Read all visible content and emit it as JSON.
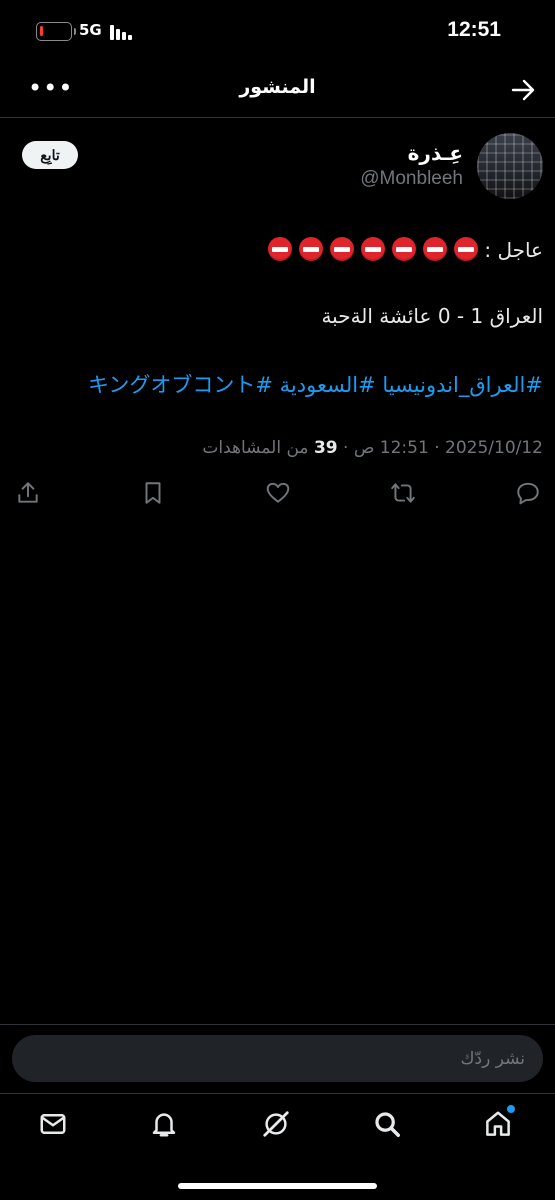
{
  "status_bar": {
    "time": "12:51",
    "network": "5G",
    "battery_level": 0.08,
    "battery_color": "#ff3b30"
  },
  "header": {
    "title": "المنشور",
    "back_icon": "arrow-right-icon",
    "more_icon": "more-horizontal-icon",
    "more_label": "•••"
  },
  "tweet": {
    "display_name": "عِـذرة",
    "handle": "@Monbleeh",
    "follow_label": "تابِع",
    "breaking_label": "عاجل :",
    "emoji_count": 7,
    "emoji_icon": "no-entry-icon",
    "score_line": "العراق 1 - 0 عائشة الةحبة",
    "hashtags": "#العراق_اندونيسيا #السعودية #キングオブコント",
    "date": "2025/10/12",
    "time": "12:51 ص",
    "views_count": "39",
    "views_label": "من المشاهدات"
  },
  "actions": {
    "items": [
      "share-icon",
      "bookmark-icon",
      "like-icon",
      "retweet-icon",
      "reply-icon"
    ]
  },
  "reply": {
    "placeholder": "نشر ردّك"
  },
  "bottom_nav": {
    "items": [
      "messages-icon",
      "notifications-icon",
      "grok-icon",
      "search-icon",
      "home-icon"
    ],
    "accent_color": "#1d9bf0"
  }
}
